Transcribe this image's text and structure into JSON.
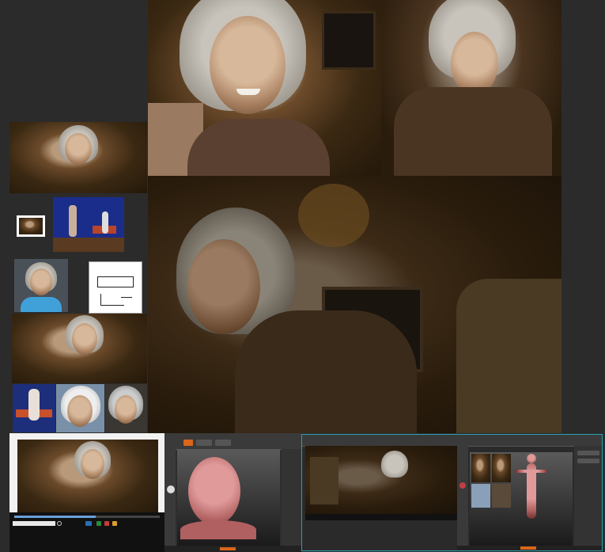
{
  "colors": {
    "canvas_bg": "#2b2b2b",
    "accent_orange": "#d9661a",
    "accent_blue": "#2a6fb0",
    "selection_outline": "#2aa0b0"
  },
  "panels": {
    "left_refs": [
      {
        "name": "ref-still-smiling"
      },
      {
        "name": "ref-thumb-small"
      },
      {
        "name": "ref-stage-photo"
      },
      {
        "name": "ref-portrait-blue"
      },
      {
        "name": "ref-sketch-drawing"
      },
      {
        "name": "ref-still-smiling-2"
      },
      {
        "name": "ref-stage-seated"
      },
      {
        "name": "ref-portrait-white-hair"
      },
      {
        "name": "ref-portrait-side"
      }
    ],
    "main_stills": [
      {
        "name": "still-close-up-smile"
      },
      {
        "name": "still-looking-down"
      },
      {
        "name": "still-profile-dark"
      }
    ],
    "bottom": {
      "video_player": {
        "search_icon": "search-icon"
      },
      "zbrush_1": {
        "icon": "sculpt-icon"
      },
      "zbrush_2": {
        "icon": "figure-icon"
      }
    }
  }
}
